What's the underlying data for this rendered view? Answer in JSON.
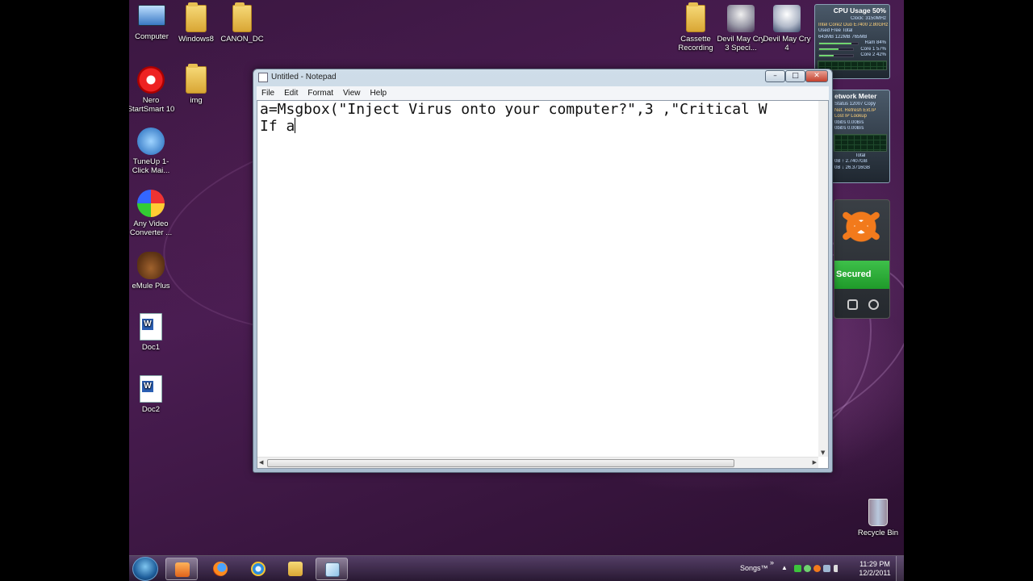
{
  "desktop": {
    "icons": [
      {
        "label": "Computer",
        "icon": "computer-icon"
      },
      {
        "label": "Windows8",
        "icon": "folder-icon"
      },
      {
        "label": "CANON_DC",
        "icon": "folder-icon"
      },
      {
        "label": "Nero StartSmart 10",
        "icon": "nero-icon"
      },
      {
        "label": "img",
        "icon": "folder-icon"
      },
      {
        "label": "TuneUp 1-Click Mai...",
        "icon": "tuneup-icon"
      },
      {
        "label": "Any Video Converter ...",
        "icon": "video-converter-icon"
      },
      {
        "label": "eMule Plus",
        "icon": "emule-icon"
      },
      {
        "label": "Doc1",
        "icon": "word-document-icon"
      },
      {
        "label": "Doc2",
        "icon": "word-document-icon"
      },
      {
        "label": "Cassette Recording",
        "icon": "folder-icon"
      },
      {
        "label": "Devil May Cry 3 Speci...",
        "icon": "game-icon"
      },
      {
        "label": "Devil May Cry 4",
        "icon": "game-icon"
      },
      {
        "label": "Recycle Bin",
        "icon": "recycle-bin-icon"
      }
    ]
  },
  "notepad": {
    "title": "Untitled - Notepad",
    "menu": [
      "File",
      "Edit",
      "Format",
      "View",
      "Help"
    ],
    "line1": "a=Msgbox(\"Inject Virus onto your computer?\",3 ,\"Critical W",
    "line2": "If a",
    "buttons": {
      "minimize": "–",
      "maximize": "□",
      "close": "✕"
    }
  },
  "gadgets": {
    "cpu": {
      "title": "CPU Usage  50%",
      "clock": "Clock: 3150MHz",
      "model": "Intel Core2 Duo E7400 2.80GHz",
      "mem_headers": "Used     Free     Total",
      "mem_values": "643MB   122MB   765MB",
      "ram": "Ram      84%",
      "core1": "Core 1    57%",
      "core2": "Core 2    42%",
      "ram_level": 0.84,
      "core1_level": 0.57,
      "core2_level": 0.42
    },
    "network": {
      "title": "etwork Meter",
      "line1": "Status 12007     Copy",
      "line2": "Net.    Refresh Ext.IP",
      "line3": "Lost      IP Lookup",
      "line4": "0bit/s      0.00B/s",
      "line5": "0bit/s      0.00B/s",
      "totals_header": "Total",
      "total_up": "0B   ↑ 2.7407GB",
      "total_down": "0B   ↓ 26.3716GB"
    },
    "avast": {
      "status": "Secured"
    }
  },
  "taskbar": {
    "tray_label": "Songs™",
    "tray_more": "»",
    "time": "11:29 PM",
    "date": "12/2/2011"
  },
  "colors": {
    "accent_green": "#2fb03a",
    "avast_orange": "#f27a1c"
  }
}
